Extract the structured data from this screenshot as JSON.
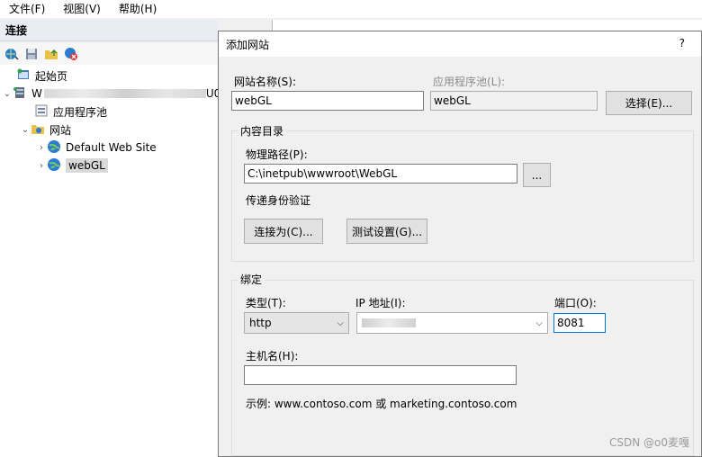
{
  "menu": [
    "文件(F)",
    "视图(V)",
    "帮助(H)"
  ],
  "connections": {
    "title": "连接",
    "tree": {
      "start_page": "起始页",
      "server_name": "W",
      "server_suffix": "U0",
      "app_pools": "应用程序池",
      "sites": "网站",
      "site1": "Default Web Site",
      "site2": "webGL"
    }
  },
  "dialog": {
    "title": "添加网站",
    "help": "?",
    "site_name_label": "网站名称(S):",
    "site_name_value": "webGL",
    "app_pool_label": "应用程序池(L):",
    "app_pool_value": "webGL",
    "select_button": "选择(E)...",
    "content": {
      "title": "内容目录",
      "physical_path_label": "物理路径(P):",
      "physical_path_value": "C:\\inetpub\\wwwroot\\WebGL",
      "browse_button": "...",
      "pass_through_label": "传递身份验证",
      "connect_as_button": "连接为(C)...",
      "test_settings_button": "测试设置(G)..."
    },
    "binding": {
      "title": "绑定",
      "type_label": "类型(T):",
      "type_value": "http",
      "ip_label": "IP 地址(I):",
      "port_label": "端口(O):",
      "port_value": "8081",
      "hostname_label": "主机名(H):",
      "hostname_value": "",
      "example": "示例: www.contoso.com 或 marketing.contoso.com"
    }
  },
  "watermark": "CSDN @o0麦嘎"
}
